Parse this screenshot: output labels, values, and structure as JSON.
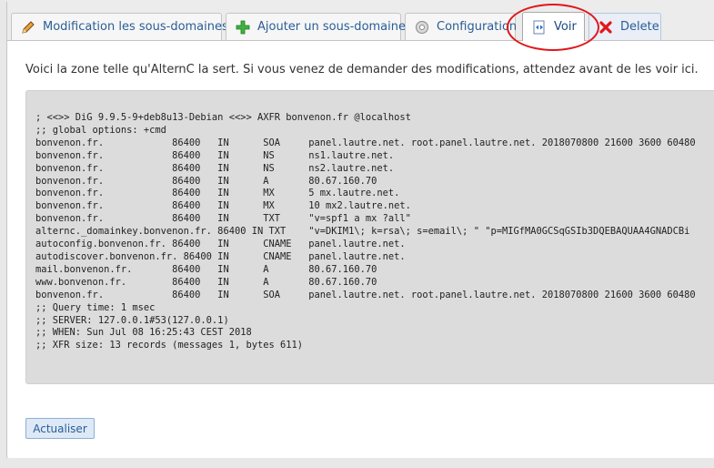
{
  "tabs": [
    {
      "label": "Modification les sous-domaines",
      "icon": "pencil-icon"
    },
    {
      "label": "Ajouter un sous-domaine",
      "icon": "plus-icon"
    },
    {
      "label": "Configuration",
      "icon": "gear-icon"
    },
    {
      "label": "Voir",
      "icon": "view-icon",
      "active": true
    },
    {
      "label": "Delete",
      "icon": "delete-x-icon"
    }
  ],
  "colors": {
    "accent": "#2a5d96",
    "highlight": "#e0171b",
    "zone_bg": "#dcdcdc"
  },
  "intro_text": "Voici la zone telle qu'AlternC la sert. Si vous venez de demander des modifications, attendez avant de les voir ici.",
  "zone_output": "; <<>> DiG 9.9.5-9+deb8u13-Debian <<>> AXFR bonvenon.fr @localhost\n;; global options: +cmd\nbonvenon.fr.            86400   IN      SOA     panel.lautre.net. root.panel.lautre.net. 2018070800 21600 3600 60480\nbonvenon.fr.            86400   IN      NS      ns1.lautre.net.\nbonvenon.fr.            86400   IN      NS      ns2.lautre.net.\nbonvenon.fr.            86400   IN      A       80.67.160.70\nbonvenon.fr.            86400   IN      MX      5 mx.lautre.net.\nbonvenon.fr.            86400   IN      MX      10 mx2.lautre.net.\nbonvenon.fr.            86400   IN      TXT     \"v=spf1 a mx ?all\"\nalternc._domainkey.bonvenon.fr. 86400 IN TXT    \"v=DKIM1\\; k=rsa\\; s=email\\; \" \"p=MIGfMA0GCSqGSIb3DQEBAQUAA4GNADCBi\nautoconfig.bonvenon.fr. 86400   IN      CNAME   panel.lautre.net.\nautodiscover.bonvenon.fr. 86400 IN      CNAME   panel.lautre.net.\nmail.bonvenon.fr.       86400   IN      A       80.67.160.70\nwww.bonvenon.fr.        86400   IN      A       80.67.160.70\nbonvenon.fr.            86400   IN      SOA     panel.lautre.net. root.panel.lautre.net. 2018070800 21600 3600 60480\n;; Query time: 1 msec\n;; SERVER: 127.0.0.1#53(127.0.0.1)\n;; WHEN: Sun Jul 08 16:25:43 CEST 2018\n;; XFR size: 13 records (messages 1, bytes 611)",
  "refresh_button": "Actualiser"
}
